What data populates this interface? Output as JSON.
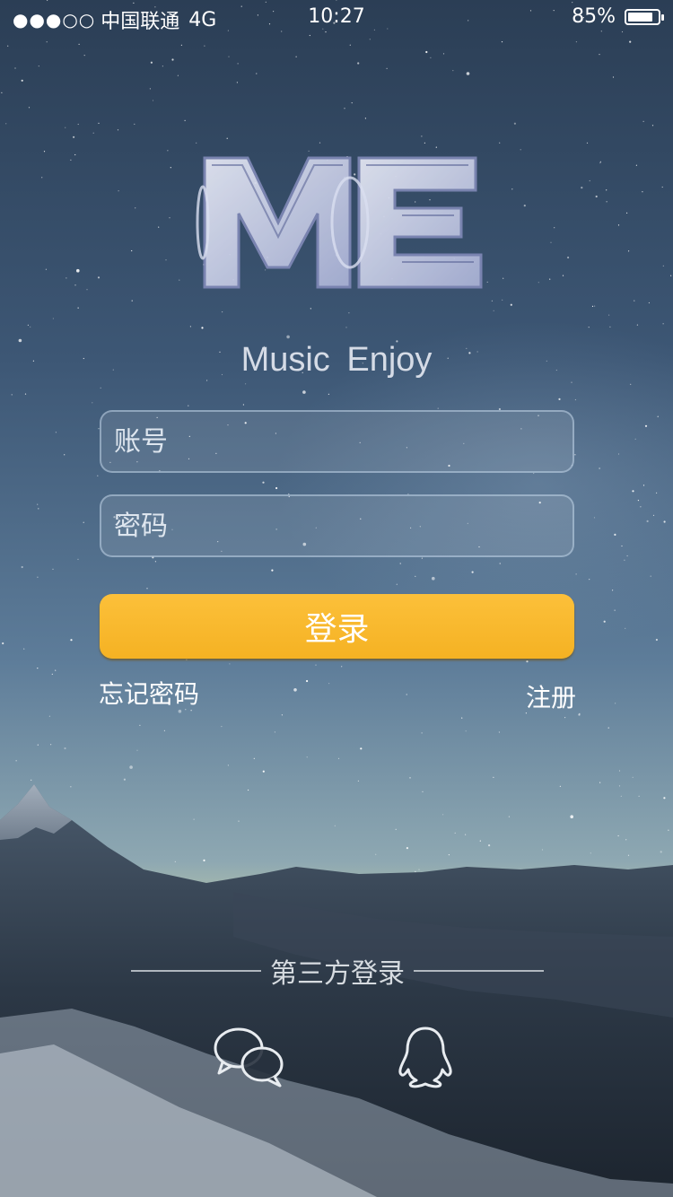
{
  "status_bar": {
    "signal": "●●●○○",
    "carrier": "中国联通",
    "network": "4G",
    "time": "10:27",
    "battery_percent": "85%",
    "battery_level": 0.85
  },
  "logo": {
    "letters": "ME"
  },
  "tagline": "Music  Enjoy",
  "form": {
    "account_placeholder": "账号",
    "password_placeholder": "密码",
    "login_label": "登录"
  },
  "links": {
    "forgot_password": "忘记密码",
    "register": "注册"
  },
  "third_party": {
    "title": "第三方登录",
    "providers": [
      {
        "name": "wechat",
        "icon": "wechat-icon"
      },
      {
        "name": "qq",
        "icon": "qq-icon"
      }
    ]
  },
  "colors": {
    "login_button": "#f9b830",
    "text": "#ffffff"
  }
}
